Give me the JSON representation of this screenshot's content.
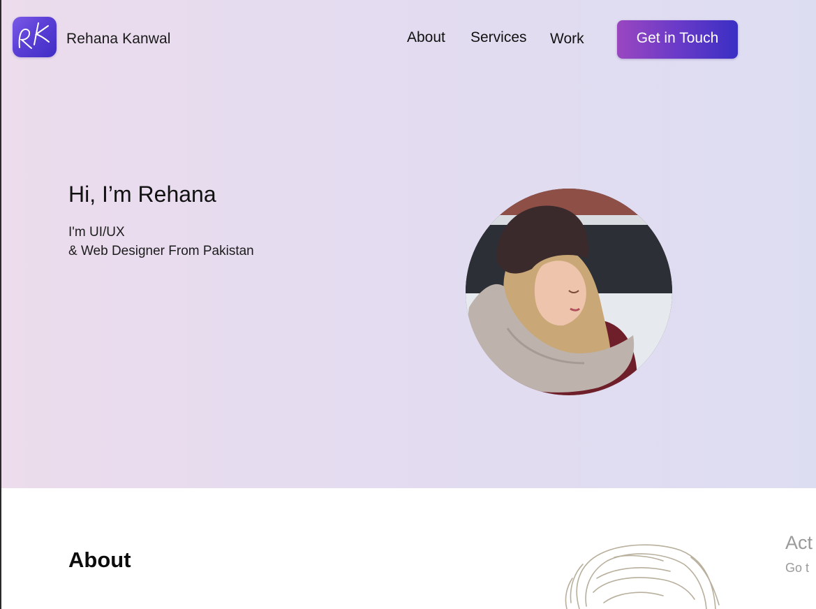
{
  "brand": {
    "name": "Rehana Kanwal",
    "logo_icon": "rk-monogram-icon",
    "logo_colors": [
      "#7b5ae6",
      "#3f2ec4"
    ]
  },
  "nav": {
    "items": [
      {
        "label": "About"
      },
      {
        "label": "Services"
      },
      {
        "label": "Work"
      }
    ],
    "cta_label": "Get in Touch",
    "cta_colors": [
      "#9a47c0",
      "#3a2fc4"
    ]
  },
  "hero": {
    "title": "Hi, I’m Rehana",
    "subtitle_line1": "I'm UI/UX",
    "subtitle_line2": "& Web Designer From Pakistan",
    "portrait": "profile-portrait-image",
    "background": [
      "#ecdcec",
      "#ddddf2"
    ]
  },
  "about": {
    "title": "About",
    "illustration": "sketch-illustration-image"
  },
  "watermark": {
    "line1": "Act",
    "line2": "Go t"
  }
}
